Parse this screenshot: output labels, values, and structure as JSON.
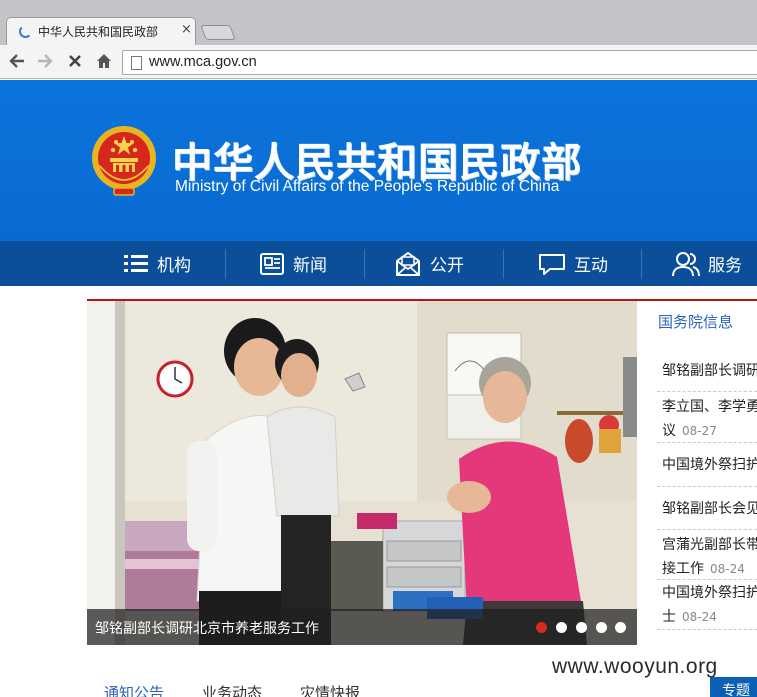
{
  "browser": {
    "tab_title": "中华人民共和国民政部",
    "tab_close": "×",
    "url": "www.mca.gov.cn",
    "nav_icons": {
      "back": "back-arrow-icon",
      "forward": "forward-arrow-icon",
      "stop": "stop-icon",
      "home": "home-icon",
      "page": "page-icon"
    }
  },
  "header": {
    "title_cn": "中华人民共和国民政部",
    "title_en": "Ministry of Civil Affairs of the People's Republic of China",
    "brand_color": "#0b74dd",
    "nav_color": "#0b4f9a"
  },
  "nav": {
    "items": [
      {
        "label": "机构",
        "icon": "list-icon"
      },
      {
        "label": "新闻",
        "icon": "news-icon"
      },
      {
        "label": "公开",
        "icon": "envelope-icon"
      },
      {
        "label": "互动",
        "icon": "chat-icon"
      },
      {
        "label": "服务",
        "icon": "users-icon"
      }
    ]
  },
  "carousel": {
    "caption": "邹铭副部长调研北京市养老服务工作",
    "slides": 5,
    "active_slide": 1,
    "accent": "#d82b1f"
  },
  "info_panel": {
    "title": "国务院信息",
    "items": [
      {
        "line1": "邹铭副部长调研",
        "line2": "",
        "date": ""
      },
      {
        "line1": "李立国、李学勇",
        "line2": "议",
        "date": "08-27"
      },
      {
        "line1": "中国境外祭扫护",
        "line2": "",
        "date": ""
      },
      {
        "line1": "邹铭副部长会见",
        "line2": "",
        "date": ""
      },
      {
        "line1": "宫蒲光副部长带",
        "line2": "接工作",
        "date": "08-24"
      },
      {
        "line1": "中国境外祭扫护",
        "line2": "士",
        "date": "08-24"
      }
    ]
  },
  "bottom_tabs": [
    "通知公告",
    "业务动态",
    "灾情快报"
  ],
  "topic_button": "专题",
  "watermark": "www.wooyun.org"
}
